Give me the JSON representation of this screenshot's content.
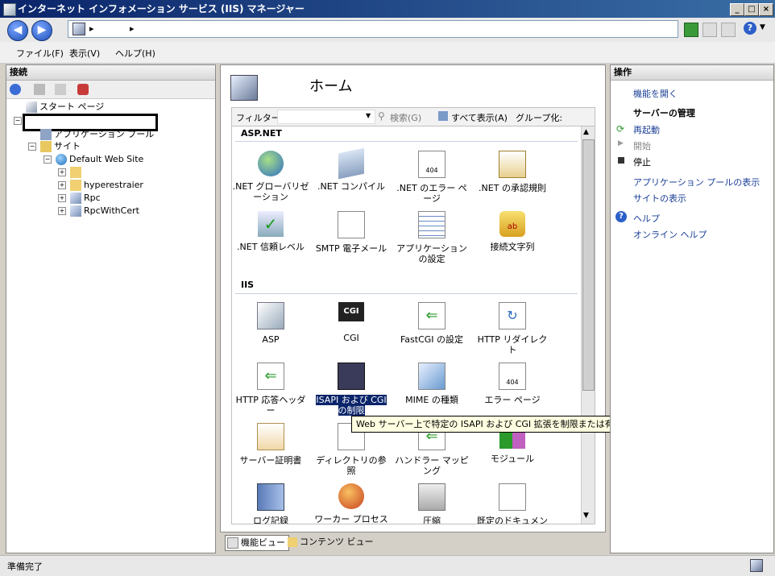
{
  "window": {
    "title": "インターネット インフォメーション サービス (IIS) マネージャー"
  },
  "address": {
    "segment1": "▸",
    "segment2": "▸"
  },
  "menu": [
    "ファイル(F)",
    "表示(V)",
    "ヘルプ(H)"
  ],
  "connections": {
    "header": "接続",
    "start_page": "スタート ページ",
    "app_pools": "アプリケーション プール",
    "sites": "サイト",
    "default_site": "Default Web Site",
    "children": [
      "",
      "hyperestraier",
      "Rpc",
      "RpcWithCert"
    ]
  },
  "home": {
    "title": "ホーム",
    "filter_label": "フィルター:",
    "search_label": "検索(G)",
    "show_all_label": "すべて表示(A)",
    "group_label": "グループ化:",
    "groups": [
      {
        "name": "ASP.NET",
        "features": [
          ".NET グローバリゼーション",
          ".NET コンパイル",
          ".NET のエラー ページ",
          ".NET の承認規則",
          ".NET 信頼レベル",
          "SMTP 電子メール",
          "アプリケーションの設定",
          "接続文字列"
        ]
      },
      {
        "name": "IIS",
        "features": [
          "ASP",
          "CGI",
          "FastCGI の設定",
          "HTTP リダイレクト",
          "HTTP 応答ヘッダー",
          "ISAPI および CGI の制限",
          "MIME の種類",
          "エラー ページ",
          "サーバー証明書",
          "ディレクトリの参照",
          "ハンドラー マッピング",
          "モジュール",
          "ログ記録",
          "ワーカー プロセス",
          "圧縮",
          "既定のドキュメント"
        ]
      }
    ],
    "tooltip": "Web サーバー上で特定の ISAPI および CGI 拡張を制限または有効化します",
    "icon_text": {
      "cgi": "CGI",
      "err": "404",
      "ab": "ab"
    }
  },
  "viewtabs": {
    "features": "機能ビュー",
    "content": "コンテンツ ビュー"
  },
  "actions": {
    "header": "操作",
    "open_feature": "機能を開く",
    "server_mgmt": "サーバーの管理",
    "restart": "再起動",
    "start": "開始",
    "stop": "停止",
    "view_pools": "アプリケーション プールの表示",
    "view_sites": "サイトの表示",
    "help": "ヘルプ",
    "online_help": "オンライン ヘルプ"
  },
  "status": {
    "text": "準備完了"
  }
}
